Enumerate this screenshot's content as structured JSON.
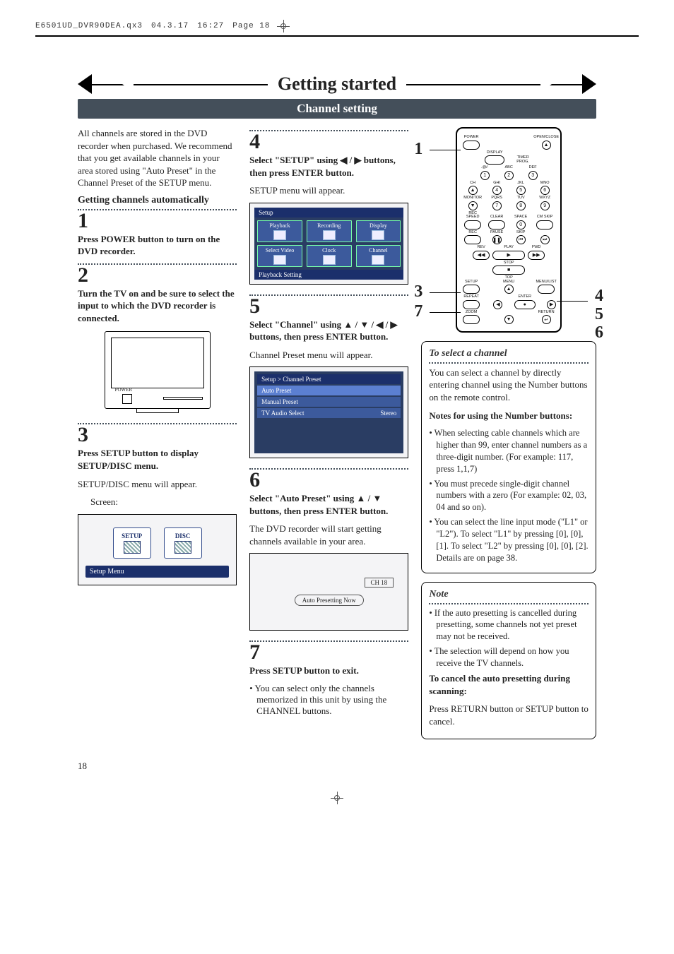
{
  "meta": {
    "file": "E6501UD_DVR90DEA.qx3",
    "date": "04.3.17",
    "time": "16:27",
    "page": "Page 18"
  },
  "title": "Getting started",
  "subtitle": "Channel setting",
  "intro": "All channels are stored in the DVD recorder when purchased. We recommend that you get available channels in your area stored using \"Auto Preset\" in the Channel Preset of the SETUP menu.",
  "auto_head": "Getting channels automatically",
  "steps": {
    "s1": {
      "num": "1",
      "text": "Press POWER button to turn on the DVD recorder."
    },
    "s2": {
      "num": "2",
      "text": "Turn the TV on and be sure to select the input to which the DVD recorder is connected."
    },
    "s3": {
      "num": "3",
      "head": "Press SETUP button to display SETUP/DISC menu.",
      "sub": "SETUP/DISC menu will appear.",
      "screen_label": "Screen:"
    },
    "s4": {
      "num": "4",
      "head": "Select \"SETUP\" using ◀ / ▶ buttons, then press ENTER button.",
      "sub": "SETUP menu will appear."
    },
    "s5": {
      "num": "5",
      "head": "Select \"Channel\" using ▲ / ▼ / ◀ / ▶ buttons, then press ENTER button.",
      "sub": "Channel Preset menu will appear."
    },
    "s6": {
      "num": "6",
      "head": "Select \"Auto Preset\" using ▲ / ▼ buttons, then press ENTER button.",
      "sub": "The DVD recorder will start getting channels available in your area."
    },
    "s7": {
      "num": "7",
      "head": "Press SETUP button to exit.",
      "bullet": "You can select only the channels memorized in this unit by using the CHANNEL buttons."
    }
  },
  "screens": {
    "setup_disc": {
      "tile1": "SETUP",
      "tile2": "DISC",
      "footer": "Setup Menu"
    },
    "setup_grid": {
      "title": "Setup",
      "cells": [
        "Playback",
        "Recording",
        "Display",
        "Select Video",
        "Clock",
        "Channel"
      ],
      "footer": "Playback Setting"
    },
    "channel_preset": {
      "title": "Setup > Channel Preset",
      "rows": [
        "Auto Preset",
        "Manual Preset",
        "TV Audio Select"
      ],
      "right": "Stereo"
    },
    "auto_now": {
      "ch": "CH 18",
      "msg": "Auto Presetting Now"
    }
  },
  "tv": {
    "power": "POWER"
  },
  "remote": {
    "top": {
      "power": "POWER",
      "openclose": "OPEN/CLOSE",
      "display": "DISPLAY",
      "timer": "TIMER PROG."
    },
    "keypad": [
      [
        ".@/:",
        "ABC",
        "DEF"
      ],
      [
        "1",
        "2",
        "3"
      ],
      [
        "GHI",
        "JKL",
        "MNO"
      ],
      [
        "4",
        "5",
        "6"
      ],
      [
        "PQRS",
        "TUV",
        "WXYZ"
      ],
      [
        "7",
        "8",
        "9"
      ],
      [
        "CLEAR",
        "SPACE",
        "CM SKIP"
      ],
      [
        "",
        "0",
        ""
      ]
    ],
    "left_col": [
      "CH",
      "MONITOR",
      "REC SPEED",
      "REC"
    ],
    "mid1": [
      "PAUSE",
      "SKIP"
    ],
    "transport": {
      "rev": "REV",
      "play": "PLAY",
      "fwd": "FWD",
      "stop": "STOP"
    },
    "row_setup": [
      "SETUP",
      "TOP MENU",
      "",
      "MENU/LIST"
    ],
    "enter": "ENTER",
    "row_repeat": "REPEAT",
    "row_zoom": "ZOOM",
    "return": "RETURN"
  },
  "callouts": {
    "c1": "1",
    "c3": "3",
    "c4": "4",
    "c5": "5",
    "c6": "6",
    "c7": "7"
  },
  "panel_select": {
    "title": "To select a channel",
    "p1": "You can select a channel by directly entering channel using the Number buttons on the remote control.",
    "notes_head": "Notes for using the Number buttons:",
    "b1": "When selecting cable channels which are higher than 99, enter channel numbers as a three-digit number. (For example: 117, press 1,1,7)",
    "b2": "You must precede single-digit channel numbers with a zero (For example: 02, 03, 04 and so on).",
    "b3": "You can select the line input mode (\"L1\" or \"L2\").  To select \"L1\" by pressing [0], [0], [1]. To select \"L2\" by pressing [0], [0], [2]. Details are on page 38."
  },
  "panel_note": {
    "title": "Note",
    "b1": "If the auto presetting is cancelled during presetting, some channels not yet preset may not be received.",
    "b2": "The selection will depend on how you receive the TV channels.",
    "cancel_head": "To cancel the auto presetting during scanning:",
    "cancel_body": "Press RETURN button or SETUP button to cancel."
  },
  "pagenum": "18"
}
